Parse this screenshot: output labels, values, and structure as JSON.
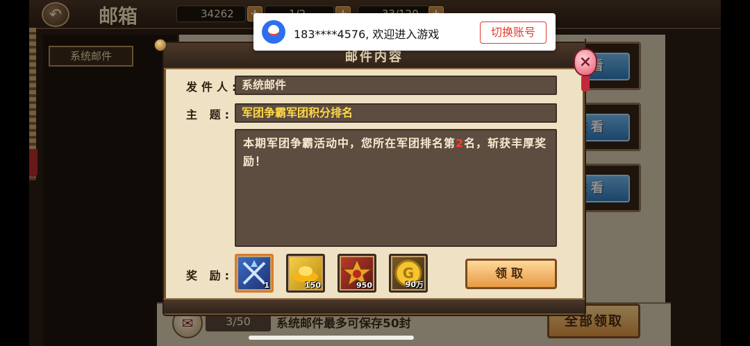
{
  "header": {
    "title": "邮箱",
    "resources": [
      {
        "icon": "gold-ingot-icon",
        "value": "34262"
      },
      {
        "icon": "coin-icon",
        "value": "1/2"
      },
      {
        "icon": "stamina-icon",
        "value": "33/120"
      }
    ]
  },
  "sidebar": {
    "tab_system": "系统邮件"
  },
  "mail_list": {
    "view_label": "查看",
    "count": "3/50",
    "hint": "系统邮件最多可保存50封",
    "claim_all_label": "全部领取"
  },
  "dialog": {
    "title": "邮件内容",
    "sender_label": "发件人:",
    "sender_value": "系统邮件",
    "subject_label": "主 题:",
    "subject_value": "军团争霸军团积分排名",
    "body_before": "本期军团争霸活动中，您所在军团排名第",
    "body_highlight": "2",
    "body_after": "名，斩获丰厚奖励！",
    "rewards_label": "奖 励:",
    "rewards": [
      {
        "icon": "crossed-swords-icon",
        "qty": "1"
      },
      {
        "icon": "gold-ingot-icon",
        "qty": "150"
      },
      {
        "icon": "legion-star-medal-icon",
        "qty": "950"
      },
      {
        "icon": "gold-coin-icon",
        "qty": "90万"
      }
    ],
    "claim_label": "领取"
  },
  "toast": {
    "message": "183****4576, 欢迎进入游戏",
    "switch_label": "切换账号"
  },
  "colors": {
    "subject": "#ffd84a",
    "highlight": "#ff3a2a",
    "view_button": "#2f78b6",
    "toast_accent": "#e33a2f"
  }
}
